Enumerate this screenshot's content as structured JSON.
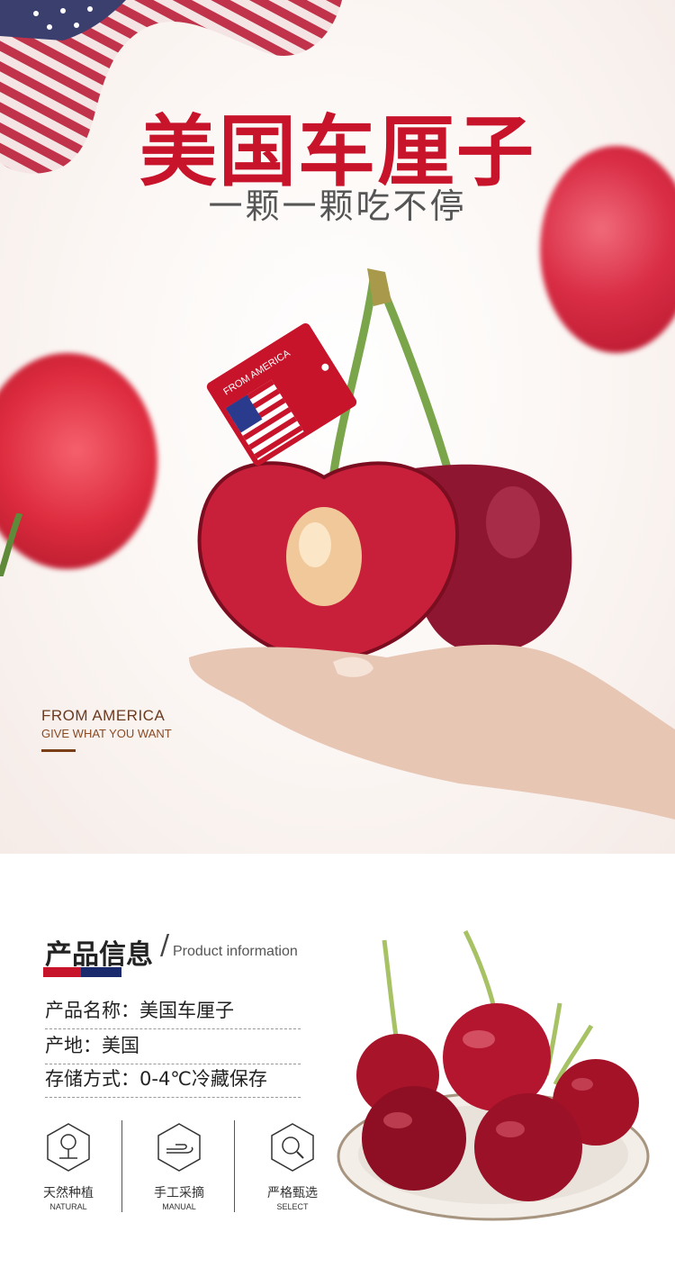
{
  "hero": {
    "title": "美国车厘子",
    "subtitle": "一颗一颗吃不停",
    "tag_text": "FROM AMERICA",
    "from_line1": "FROM AMERICA",
    "from_line2": "GIVE WHAT YOU WANT"
  },
  "info": {
    "title": "产品信息",
    "slash": "/",
    "title_en": "Product information",
    "rows": [
      {
        "text": "产品名称：美国车厘子"
      },
      {
        "text": "产地：美国"
      },
      {
        "text": "存储方式：0-4℃冷藏保存"
      }
    ],
    "features": [
      {
        "cn": "天然种植",
        "en": "NATURAL",
        "icon": "tree-icon"
      },
      {
        "cn": "手工采摘",
        "en": "MANUAL",
        "icon": "hand-icon"
      },
      {
        "cn": "严格甄选",
        "en": "SELECT",
        "icon": "magnifier-icon"
      }
    ]
  },
  "colors": {
    "brand_red": "#c8142b",
    "navy": "#1a2a6c",
    "brown": "#6b3a1f"
  }
}
